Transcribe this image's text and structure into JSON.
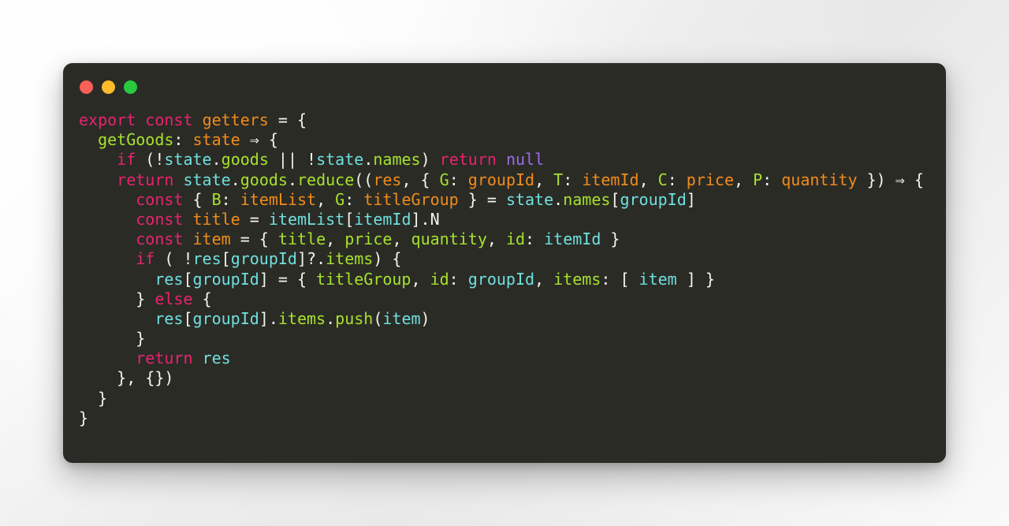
{
  "window": {
    "name": "code-snippet-window",
    "background_hex": "#2b2b26",
    "page_background_hex": "#f2f2f2",
    "traffic_lights": [
      {
        "name": "close",
        "color": "#fc5f57"
      },
      {
        "name": "minimize",
        "color": "#fcbc2c"
      },
      {
        "name": "maximize",
        "color": "#28c93f"
      }
    ]
  },
  "theme": {
    "keyword": "#e6246e",
    "literal": "#9a6ee8",
    "function": "#f08c1b",
    "variable": "#6fe0df",
    "property": "#a6e22e",
    "punctuation": "#f4f4ef"
  },
  "code": {
    "language": "javascript",
    "plain_text": "export const getters = {\n  getGoods: state => {\n    if (!state.goods || !state.names) return null\n    return state.goods.reduce((res, { G: groupId, T: itemId, C: price, P: quantity }) => {\n      const { B: itemList, G: titleGroup } = state.names[groupId]\n      const title = itemList[itemId].N\n      const item = { title, price, quantity, id: itemId }\n      if ( !res[groupId]?.items) {\n        res[groupId] = { titleGroup, id: groupId, items: [ item ] }\n      } else {\n        res[groupId].items.push(item)\n      }\n      return res\n    }, {})\n  }\n}",
    "lines": [
      {
        "n": 1,
        "tokens": [
          {
            "t": "export",
            "c": "kw"
          },
          {
            "t": " ",
            "c": "pun"
          },
          {
            "t": "const",
            "c": "kw"
          },
          {
            "t": " ",
            "c": "pun"
          },
          {
            "t": "getters",
            "c": "fn"
          },
          {
            "t": " = {",
            "c": "pun"
          }
        ]
      },
      {
        "n": 2,
        "tokens": [
          {
            "t": "  ",
            "c": "pun"
          },
          {
            "t": "getGoods",
            "c": "prop"
          },
          {
            "t": ": ",
            "c": "pun"
          },
          {
            "t": "state",
            "c": "fn"
          },
          {
            "t": " ",
            "c": "pun"
          },
          {
            "t": "⇒",
            "c": "pun"
          },
          {
            "t": " {",
            "c": "pun"
          }
        ]
      },
      {
        "n": 3,
        "tokens": [
          {
            "t": "    ",
            "c": "pun"
          },
          {
            "t": "if",
            "c": "kw"
          },
          {
            "t": " (!",
            "c": "pun"
          },
          {
            "t": "state",
            "c": "var"
          },
          {
            "t": ".",
            "c": "pun"
          },
          {
            "t": "goods",
            "c": "prop"
          },
          {
            "t": " || !",
            "c": "pun"
          },
          {
            "t": "state",
            "c": "var"
          },
          {
            "t": ".",
            "c": "pun"
          },
          {
            "t": "names",
            "c": "prop"
          },
          {
            "t": ") ",
            "c": "pun"
          },
          {
            "t": "return",
            "c": "kw"
          },
          {
            "t": " ",
            "c": "pun"
          },
          {
            "t": "null",
            "c": "lit"
          }
        ]
      },
      {
        "n": 4,
        "tokens": [
          {
            "t": "    ",
            "c": "pun"
          },
          {
            "t": "return",
            "c": "kw"
          },
          {
            "t": " ",
            "c": "pun"
          },
          {
            "t": "state",
            "c": "var"
          },
          {
            "t": ".",
            "c": "pun"
          },
          {
            "t": "goods",
            "c": "prop"
          },
          {
            "t": ".",
            "c": "pun"
          },
          {
            "t": "reduce",
            "c": "prop"
          },
          {
            "t": "((",
            "c": "pun"
          },
          {
            "t": "res",
            "c": "fn"
          },
          {
            "t": ", { ",
            "c": "pun"
          },
          {
            "t": "G",
            "c": "prop"
          },
          {
            "t": ": ",
            "c": "pun"
          },
          {
            "t": "groupId",
            "c": "fn"
          },
          {
            "t": ", ",
            "c": "pun"
          },
          {
            "t": "T",
            "c": "prop"
          },
          {
            "t": ": ",
            "c": "pun"
          },
          {
            "t": "itemId",
            "c": "fn"
          },
          {
            "t": ", ",
            "c": "pun"
          },
          {
            "t": "C",
            "c": "prop"
          },
          {
            "t": ": ",
            "c": "pun"
          },
          {
            "t": "price",
            "c": "fn"
          },
          {
            "t": ", ",
            "c": "pun"
          },
          {
            "t": "P",
            "c": "prop"
          },
          {
            "t": ": ",
            "c": "pun"
          },
          {
            "t": "quantity",
            "c": "fn"
          },
          {
            "t": " }) ",
            "c": "pun"
          },
          {
            "t": "⇒",
            "c": "pun"
          },
          {
            "t": " {",
            "c": "pun"
          }
        ]
      },
      {
        "n": 5,
        "tokens": [
          {
            "t": "      ",
            "c": "pun"
          },
          {
            "t": "const",
            "c": "kw"
          },
          {
            "t": " { ",
            "c": "pun"
          },
          {
            "t": "B",
            "c": "prop"
          },
          {
            "t": ": ",
            "c": "pun"
          },
          {
            "t": "itemList",
            "c": "fn"
          },
          {
            "t": ", ",
            "c": "pun"
          },
          {
            "t": "G",
            "c": "prop"
          },
          {
            "t": ": ",
            "c": "pun"
          },
          {
            "t": "titleGroup",
            "c": "fn"
          },
          {
            "t": " } = ",
            "c": "pun"
          },
          {
            "t": "state",
            "c": "var"
          },
          {
            "t": ".",
            "c": "pun"
          },
          {
            "t": "names",
            "c": "prop"
          },
          {
            "t": "[",
            "c": "pun"
          },
          {
            "t": "groupId",
            "c": "var"
          },
          {
            "t": "]",
            "c": "pun"
          }
        ]
      },
      {
        "n": 6,
        "tokens": [
          {
            "t": "      ",
            "c": "pun"
          },
          {
            "t": "const",
            "c": "kw"
          },
          {
            "t": " ",
            "c": "pun"
          },
          {
            "t": "title",
            "c": "fn"
          },
          {
            "t": " = ",
            "c": "pun"
          },
          {
            "t": "itemList",
            "c": "var"
          },
          {
            "t": "[",
            "c": "pun"
          },
          {
            "t": "itemId",
            "c": "var"
          },
          {
            "t": "].",
            "c": "pun"
          },
          {
            "t": "N",
            "c": "pun"
          }
        ]
      },
      {
        "n": 7,
        "tokens": [
          {
            "t": "      ",
            "c": "pun"
          },
          {
            "t": "const",
            "c": "kw"
          },
          {
            "t": " ",
            "c": "pun"
          },
          {
            "t": "item",
            "c": "fn"
          },
          {
            "t": " = { ",
            "c": "pun"
          },
          {
            "t": "title",
            "c": "prop"
          },
          {
            "t": ", ",
            "c": "pun"
          },
          {
            "t": "price",
            "c": "prop"
          },
          {
            "t": ", ",
            "c": "pun"
          },
          {
            "t": "quantity",
            "c": "prop"
          },
          {
            "t": ", ",
            "c": "pun"
          },
          {
            "t": "id",
            "c": "prop"
          },
          {
            "t": ": ",
            "c": "pun"
          },
          {
            "t": "itemId",
            "c": "var"
          },
          {
            "t": " }",
            "c": "pun"
          }
        ]
      },
      {
        "n": 8,
        "tokens": [
          {
            "t": "      ",
            "c": "pun"
          },
          {
            "t": "if",
            "c": "kw"
          },
          {
            "t": " ( !",
            "c": "pun"
          },
          {
            "t": "res",
            "c": "var"
          },
          {
            "t": "[",
            "c": "pun"
          },
          {
            "t": "groupId",
            "c": "var"
          },
          {
            "t": "]?.",
            "c": "pun"
          },
          {
            "t": "items",
            "c": "prop"
          },
          {
            "t": ") {",
            "c": "pun"
          }
        ]
      },
      {
        "n": 9,
        "tokens": [
          {
            "t": "        ",
            "c": "pun"
          },
          {
            "t": "res",
            "c": "var"
          },
          {
            "t": "[",
            "c": "pun"
          },
          {
            "t": "groupId",
            "c": "var"
          },
          {
            "t": "] = { ",
            "c": "pun"
          },
          {
            "t": "titleGroup",
            "c": "prop"
          },
          {
            "t": ", ",
            "c": "pun"
          },
          {
            "t": "id",
            "c": "prop"
          },
          {
            "t": ": ",
            "c": "pun"
          },
          {
            "t": "groupId",
            "c": "var"
          },
          {
            "t": ", ",
            "c": "pun"
          },
          {
            "t": "items",
            "c": "prop"
          },
          {
            "t": ": [ ",
            "c": "pun"
          },
          {
            "t": "item",
            "c": "var"
          },
          {
            "t": " ] }",
            "c": "pun"
          }
        ]
      },
      {
        "n": 10,
        "tokens": [
          {
            "t": "      } ",
            "c": "pun"
          },
          {
            "t": "else",
            "c": "kw"
          },
          {
            "t": " {",
            "c": "pun"
          }
        ]
      },
      {
        "n": 11,
        "tokens": [
          {
            "t": "        ",
            "c": "pun"
          },
          {
            "t": "res",
            "c": "var"
          },
          {
            "t": "[",
            "c": "pun"
          },
          {
            "t": "groupId",
            "c": "var"
          },
          {
            "t": "].",
            "c": "pun"
          },
          {
            "t": "items",
            "c": "prop"
          },
          {
            "t": ".",
            "c": "pun"
          },
          {
            "t": "push",
            "c": "prop"
          },
          {
            "t": "(",
            "c": "pun"
          },
          {
            "t": "item",
            "c": "var"
          },
          {
            "t": ")",
            "c": "pun"
          }
        ]
      },
      {
        "n": 12,
        "tokens": [
          {
            "t": "      }",
            "c": "pun"
          }
        ]
      },
      {
        "n": 13,
        "tokens": [
          {
            "t": "      ",
            "c": "pun"
          },
          {
            "t": "return",
            "c": "kw"
          },
          {
            "t": " ",
            "c": "pun"
          },
          {
            "t": "res",
            "c": "var"
          }
        ]
      },
      {
        "n": 14,
        "tokens": [
          {
            "t": "    }, {})",
            "c": "pun"
          }
        ]
      },
      {
        "n": 15,
        "tokens": [
          {
            "t": "  }",
            "c": "pun"
          }
        ]
      },
      {
        "n": 16,
        "tokens": [
          {
            "t": "}",
            "c": "pun"
          }
        ]
      }
    ]
  }
}
